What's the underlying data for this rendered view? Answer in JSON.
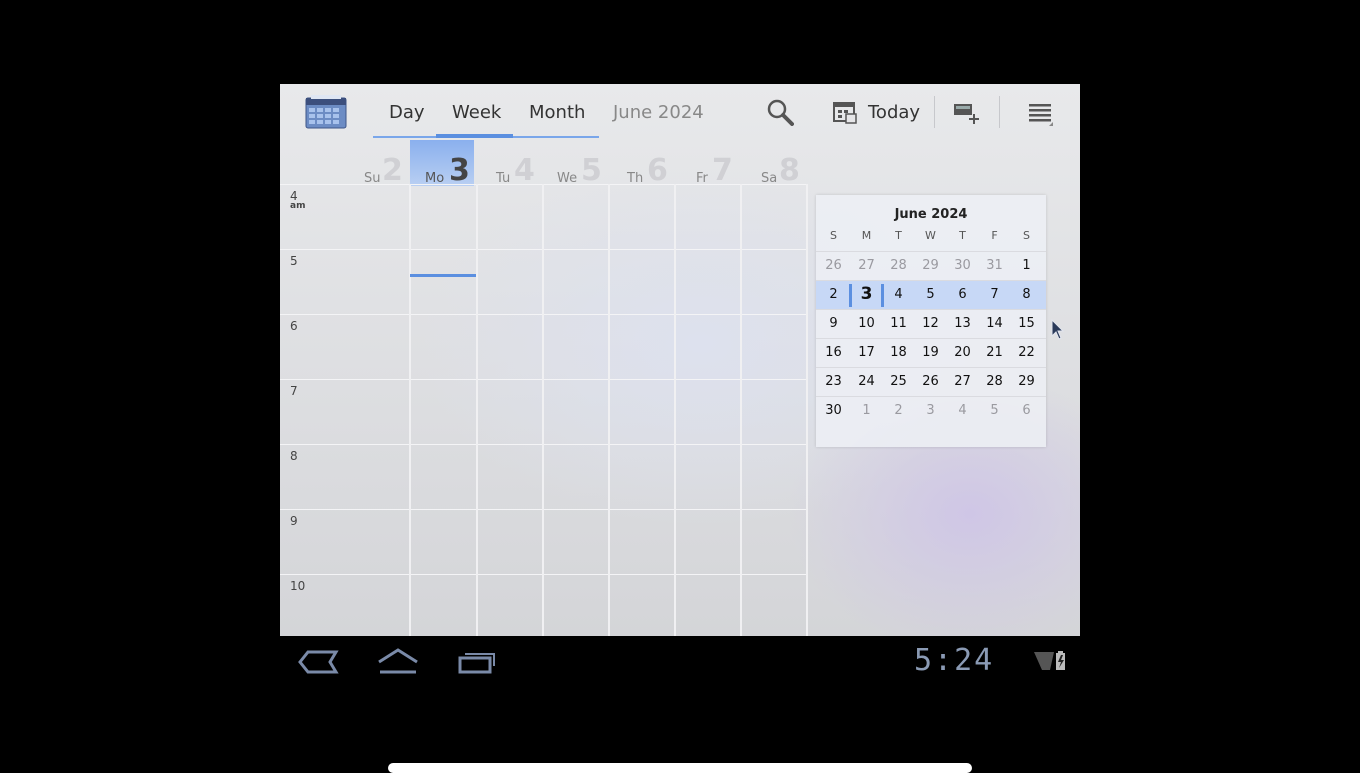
{
  "actionbar": {
    "app_icon": "calendar-app-icon",
    "tabs": [
      {
        "label": "Day",
        "selected": false
      },
      {
        "label": "Week",
        "selected": true
      },
      {
        "label": "Month",
        "selected": false
      }
    ],
    "current_month": "June 2024",
    "search_icon": "search-icon",
    "today_icon": "calendar-today-icon",
    "today_label": "Today",
    "new_event_icon": "new-event-icon",
    "overflow_icon": "overflow-menu-icon"
  },
  "week": {
    "days": [
      {
        "abbr": "Su",
        "num": "2"
      },
      {
        "abbr": "Mo",
        "num": "3",
        "selected": true
      },
      {
        "abbr": "Tu",
        "num": "4"
      },
      {
        "abbr": "We",
        "num": "5"
      },
      {
        "abbr": "Th",
        "num": "6"
      },
      {
        "abbr": "Fr",
        "num": "7"
      },
      {
        "abbr": "Sa",
        "num": "8"
      }
    ],
    "hours": [
      "4",
      "5",
      "6",
      "7",
      "8",
      "9",
      "10"
    ],
    "am_label": "am"
  },
  "mini_calendar": {
    "title": "June 2024",
    "dow": [
      "S",
      "M",
      "T",
      "W",
      "T",
      "F",
      "S"
    ],
    "weeks": [
      [
        {
          "d": "26",
          "dim": true
        },
        {
          "d": "27",
          "dim": true
        },
        {
          "d": "28",
          "dim": true
        },
        {
          "d": "29",
          "dim": true
        },
        {
          "d": "30",
          "dim": true
        },
        {
          "d": "31",
          "dim": true
        },
        {
          "d": "1"
        }
      ],
      [
        {
          "d": "2"
        },
        {
          "d": "3",
          "today": true
        },
        {
          "d": "4"
        },
        {
          "d": "5"
        },
        {
          "d": "6"
        },
        {
          "d": "7"
        },
        {
          "d": "8"
        }
      ],
      [
        {
          "d": "9"
        },
        {
          "d": "10"
        },
        {
          "d": "11"
        },
        {
          "d": "12"
        },
        {
          "d": "13"
        },
        {
          "d": "14"
        },
        {
          "d": "15"
        }
      ],
      [
        {
          "d": "16"
        },
        {
          "d": "17"
        },
        {
          "d": "18"
        },
        {
          "d": "19"
        },
        {
          "d": "20"
        },
        {
          "d": "21"
        },
        {
          "d": "22"
        }
      ],
      [
        {
          "d": "23"
        },
        {
          "d": "24"
        },
        {
          "d": "25"
        },
        {
          "d": "26"
        },
        {
          "d": "27"
        },
        {
          "d": "28"
        },
        {
          "d": "29"
        }
      ],
      [
        {
          "d": "30"
        },
        {
          "d": "1",
          "dim": true
        },
        {
          "d": "2",
          "dim": true
        },
        {
          "d": "3",
          "dim": true
        },
        {
          "d": "4",
          "dim": true
        },
        {
          "d": "5",
          "dim": true
        },
        {
          "d": "6",
          "dim": true
        }
      ]
    ],
    "selected_week": 1
  },
  "system_bar": {
    "back_icon": "back-icon",
    "home_icon": "home-icon",
    "recents_icon": "recent-apps-icon",
    "clock": "5:24",
    "signal_icon": "signal-icon",
    "battery_icon": "battery-charging-icon"
  },
  "colors": {
    "accent": "#5b8fe0",
    "selected_week": "#c7d8f6",
    "clock": "#8a9ab4"
  }
}
